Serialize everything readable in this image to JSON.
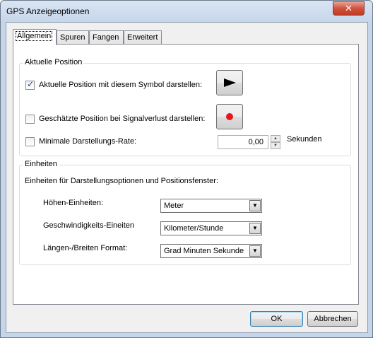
{
  "window": {
    "title": "GPS Anzeigeoptionen",
    "close_label": "✕"
  },
  "tabs": [
    {
      "label": "Allgemein",
      "active": true
    },
    {
      "label": "Spuren",
      "active": false
    },
    {
      "label": "Fangen",
      "active": false
    },
    {
      "label": "Erweitert",
      "active": false
    }
  ],
  "position_group": {
    "title": "Aktuelle Position",
    "show_symbol": {
      "label": "Aktuelle Position mit diesem Symbol darstellen:",
      "checked": true,
      "symbol_icon": "flag-arrow-icon"
    },
    "estimated": {
      "label": "Geschätzte Position bei Signalverlust darstellen:",
      "checked": false,
      "symbol_icon": "red-dot-icon"
    },
    "min_rate": {
      "label": "Minimale Darstellungs-Rate:",
      "checked": false,
      "value": "0,00",
      "unit": "Sekunden"
    }
  },
  "units_group": {
    "title": "Einheiten",
    "description": "Einheiten für Darstellungsoptionen und Positionsfenster:",
    "height": {
      "label": "Höhen-Einheiten:",
      "value": "Meter"
    },
    "speed": {
      "label": "Geschwindigkeits-Eineiten",
      "value": "Kilometer/Stunde"
    },
    "latlon": {
      "label": "Längen-/Breiten Format:",
      "value": "Grad Minuten Sekunde"
    }
  },
  "buttons": {
    "ok": "OK",
    "cancel": "Abbrechen"
  },
  "colors": {
    "title_bg": "#c6d6ea",
    "dot_red": "#e8161a",
    "check_blue": "#1c3f94"
  }
}
